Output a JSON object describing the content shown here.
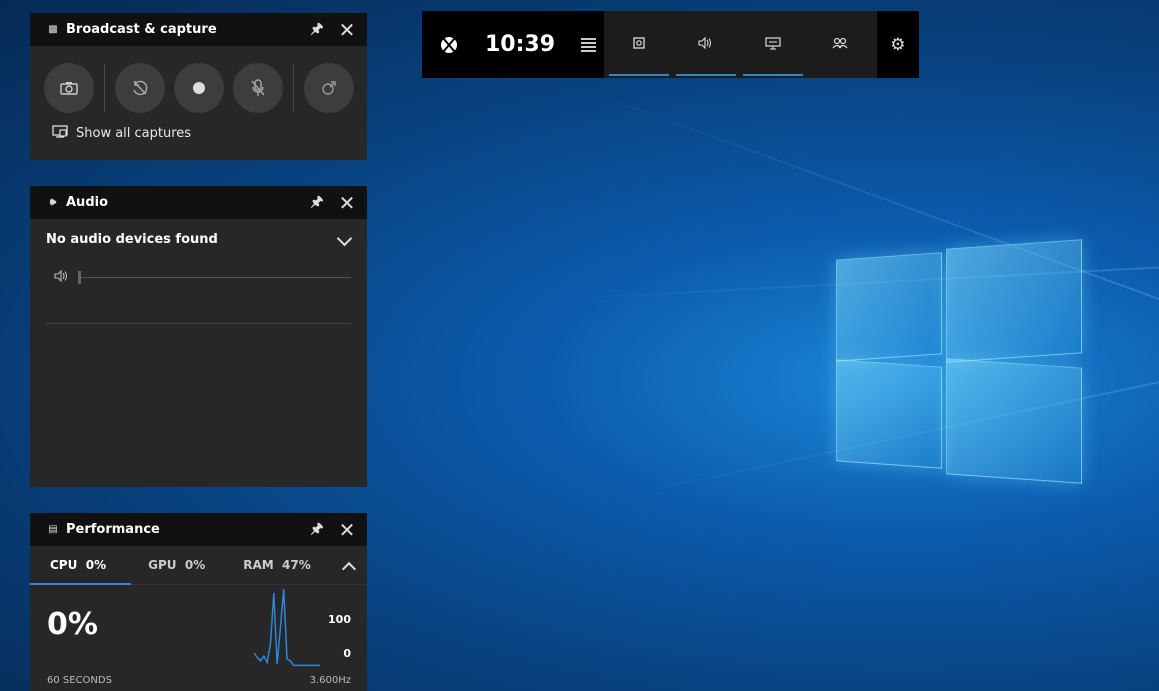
{
  "topbar": {
    "time": "10:39",
    "buttons": [
      {
        "name": "capture-widget-button",
        "icon": "capture-icon",
        "active": true
      },
      {
        "name": "audio-widget-button",
        "icon": "speaker-icon",
        "active": true
      },
      {
        "name": "performance-widget-button",
        "icon": "monitor-icon",
        "active": true
      },
      {
        "name": "social-widget-button",
        "icon": "people-icon",
        "active": false
      }
    ],
    "icons": {
      "xbox": "xbox-logo-icon",
      "menu": "widget-menu-icon",
      "settings": "gear-icon"
    }
  },
  "capture": {
    "title": "Broadcast & capture",
    "show_all": "Show all captures",
    "buttons": [
      "screenshot-icon",
      "record-last-icon",
      "record-dot-icon",
      "mic-off-icon",
      "broadcast-icon"
    ]
  },
  "audio": {
    "title": "Audio",
    "status": "No audio devices found",
    "volume": 0
  },
  "performance": {
    "title": "Performance",
    "tabs": [
      {
        "label": "CPU",
        "value": "0%",
        "selected": true
      },
      {
        "label": "GPU",
        "value": "0%",
        "selected": false
      },
      {
        "label": "RAM",
        "value": "47%",
        "selected": false
      }
    ],
    "current": "0%",
    "y_max": "100",
    "y_min": "0",
    "footer_left": "60 SECONDS",
    "footer_right": "3.600Hz",
    "accent": "#2d86d8"
  },
  "chart_data": {
    "type": "line",
    "x": [
      0,
      1,
      2,
      3,
      4,
      5,
      6,
      7,
      8,
      9,
      10,
      11,
      12,
      13,
      14,
      15,
      16,
      17,
      18,
      19,
      20
    ],
    "values": [
      18,
      12,
      8,
      14,
      6,
      30,
      95,
      4,
      50,
      100,
      10,
      8,
      2,
      2,
      2,
      2,
      2,
      2,
      2,
      2,
      2
    ],
    "ylim": [
      0,
      100
    ]
  }
}
